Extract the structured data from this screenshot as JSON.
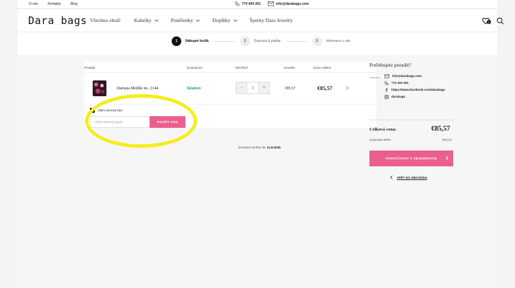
{
  "topbar": {
    "links": [
      "O nás",
      "Kontakty",
      "Blog"
    ],
    "phone": "774 404 261",
    "email": "info@darabags.com"
  },
  "header": {
    "logo": "Dara bags",
    "nav": [
      {
        "label": "Všechno zboží",
        "dropdown": false
      },
      {
        "label": "Kabelky",
        "dropdown": true
      },
      {
        "label": "Peněženky",
        "dropdown": true
      },
      {
        "label": "Doplňky",
        "dropdown": true
      },
      {
        "label": "Šperky Dara Jewelry",
        "dropdown": false
      }
    ],
    "wishlist_count": "0"
  },
  "steps": [
    {
      "num": "1",
      "label": "Nákupní košík",
      "active": true
    },
    {
      "num": "2",
      "label": "Doprava & platba",
      "active": false
    },
    {
      "num": "3",
      "label": "Informace o vás",
      "active": false
    }
  ],
  "cart": {
    "columns": {
      "product": "Produkt",
      "availability": "Dostupnost",
      "quantity": "Množství",
      "unit_price": "Cena/ks",
      "total_price": "Cena celkem"
    },
    "items": [
      {
        "name": "Dariana Middle no. 2144",
        "availability": "Skladem",
        "quantity": "1",
        "unit_price": "€85,57",
        "total_price": "€85,57"
      }
    ],
    "coupon": {
      "checkbox_label": "Mám slevový kód",
      "checked": true,
      "placeholder": "Vložit slevový kupón",
      "button": "POUŽÍT KÓD"
    },
    "delivery_label": "Doručení možné do:",
    "delivery_date": "11.9.2025"
  },
  "sidebar": {
    "help_title": "Potřebujete poradit?",
    "avatar_text": "darabags",
    "contacts": [
      {
        "icon": "mail-icon",
        "text": "info@darabags.com"
      },
      {
        "icon": "phone-icon",
        "text": "774 404 261"
      },
      {
        "icon": "facebook-icon",
        "text": "https://www.facebook.com/darabags"
      },
      {
        "icon": "instagram-icon",
        "text": "darabags"
      }
    ],
    "total_label": "Celková cena:",
    "total_value": "€85,57",
    "vat_label": "Cena bez DPH:",
    "vat_value": "€70,72",
    "continue_button": "POKRAČOVAT V OBJEDNÁVCE",
    "back_link": "ZPĚT DO OBCHODU"
  },
  "colors": {
    "accent": "#ea5f8f",
    "stock": "#26a14a",
    "highlight": "#f7ec1c"
  }
}
